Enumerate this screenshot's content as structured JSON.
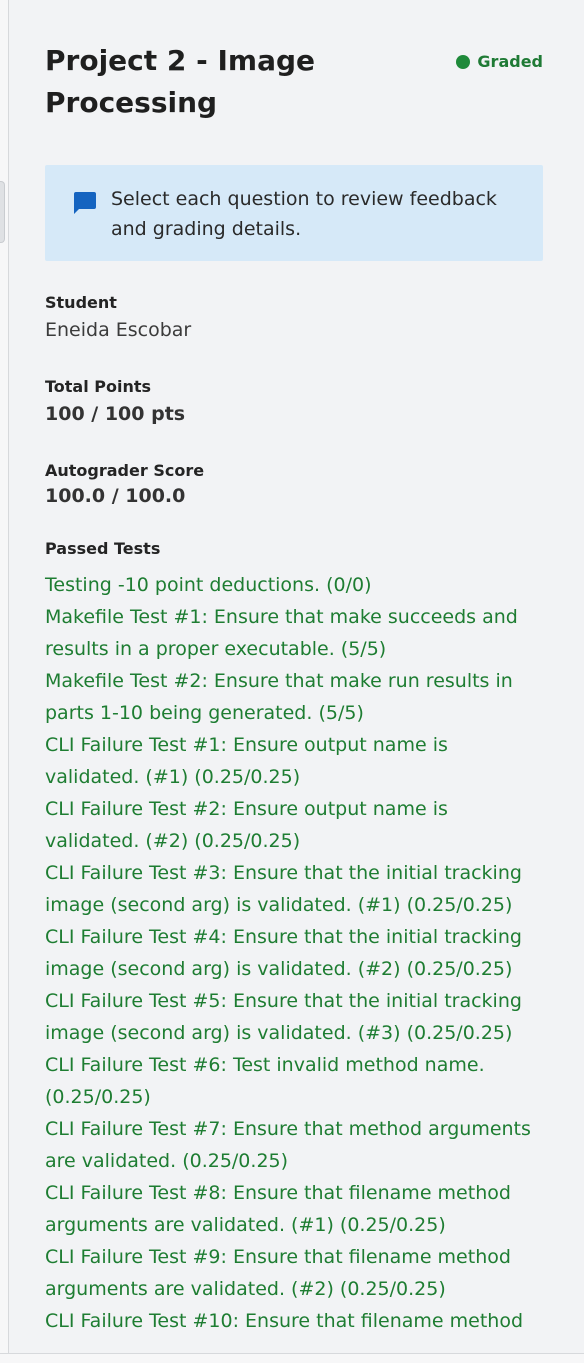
{
  "header": {
    "title": "Project 2 - Image Processing",
    "status": "Graded",
    "status_color": "#1f8a3a"
  },
  "info": {
    "icon": "chat-bubble-icon",
    "icon_color": "#1564c0",
    "text": "Select each question to review feedback and grading details."
  },
  "student": {
    "label": "Student",
    "value": "Eneida Escobar"
  },
  "total_points": {
    "label": "Total Points",
    "value": "100 / 100 pts"
  },
  "autograder": {
    "label": "Autograder Score",
    "value": "100.0 / 100.0"
  },
  "passed_tests": {
    "label": "Passed Tests",
    "items": [
      "Testing -10 point deductions. (0/0)",
      "Makefile Test #1: Ensure that make succeeds and results in a proper executable. (5/5)",
      "Makefile Test #2: Ensure that make run results in parts 1-10 being generated. (5/5)",
      "CLI Failure Test #1: Ensure output name is validated. (#1) (0.25/0.25)",
      "CLI Failure Test #2: Ensure output name is validated. (#2) (0.25/0.25)",
      "CLI Failure Test #3: Ensure that the initial tracking image (second arg) is validated. (#1) (0.25/0.25)",
      "CLI Failure Test #4: Ensure that the initial tracking image (second arg) is validated. (#2) (0.25/0.25)",
      "CLI Failure Test #5: Ensure that the initial tracking image (second arg) is validated. (#3) (0.25/0.25)",
      "CLI Failure Test #6: Test invalid method name. (0.25/0.25)",
      "CLI Failure Test #7: Ensure that method arguments are validated. (0.25/0.25)",
      "CLI Failure Test #8: Ensure that filename method arguments are validated. (#1) (0.25/0.25)",
      "CLI Failure Test #9: Ensure that filename method arguments are validated. (#2) (0.25/0.25)",
      "CLI Failure Test #10: Ensure that filename method"
    ]
  }
}
